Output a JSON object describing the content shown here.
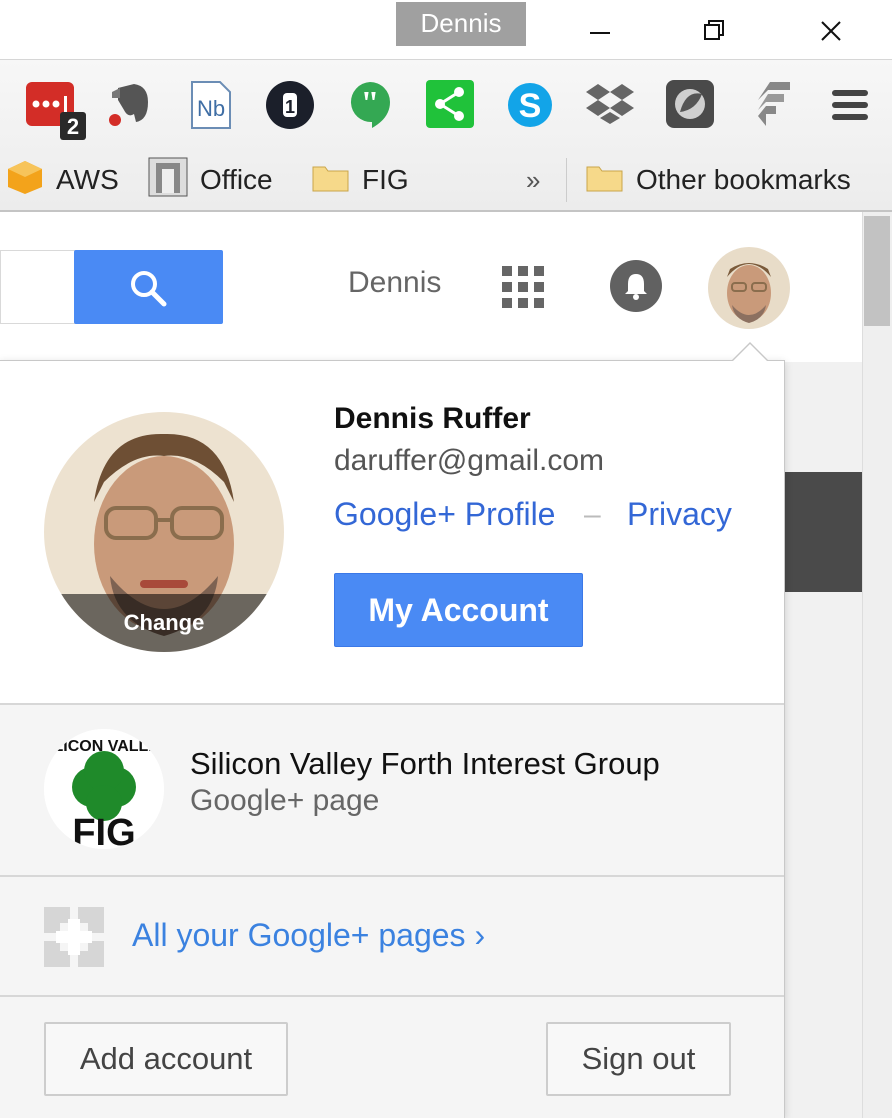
{
  "window": {
    "profile_name": "Dennis",
    "minimize_icon": "minimize-icon",
    "restore_icon": "restore-icon",
    "close_icon": "close-icon"
  },
  "extensions": [
    {
      "name": "lastpass-extension",
      "badge": "2"
    },
    {
      "name": "evernote-extension"
    },
    {
      "name": "notebook-extension",
      "label": "Nb"
    },
    {
      "name": "1password-extension",
      "label": "1"
    },
    {
      "name": "hangouts-extension"
    },
    {
      "name": "share-extension"
    },
    {
      "name": "skype-extension"
    },
    {
      "name": "dropbox-extension"
    },
    {
      "name": "shield-extension"
    },
    {
      "name": "feedly-extension"
    },
    {
      "name": "chrome-menu"
    }
  ],
  "bookmarks": {
    "items": [
      "AWS",
      "Office",
      "FIG"
    ],
    "overflow": "»",
    "other": "Other bookmarks"
  },
  "header": {
    "user_name": "Dennis"
  },
  "account": {
    "name": "Dennis Ruffer",
    "email": "daruffer@gmail.com",
    "profile_link": "Google+ Profile",
    "separator": "–",
    "privacy_link": "Privacy",
    "my_account_button": "My Account",
    "change_label": "Change"
  },
  "pages": {
    "page_name": "Silicon Valley Forth Interest Group",
    "page_type": "Google+ page",
    "logo_text_top": "SILICON VALLEY",
    "logo_text_bottom": "FIG",
    "all_pages_link": "All your Google+ pages ›"
  },
  "footer": {
    "add_account": "Add account",
    "sign_out": "Sign out"
  },
  "colors": {
    "accent_blue": "#4a8af4",
    "link_blue": "#3367d6"
  }
}
